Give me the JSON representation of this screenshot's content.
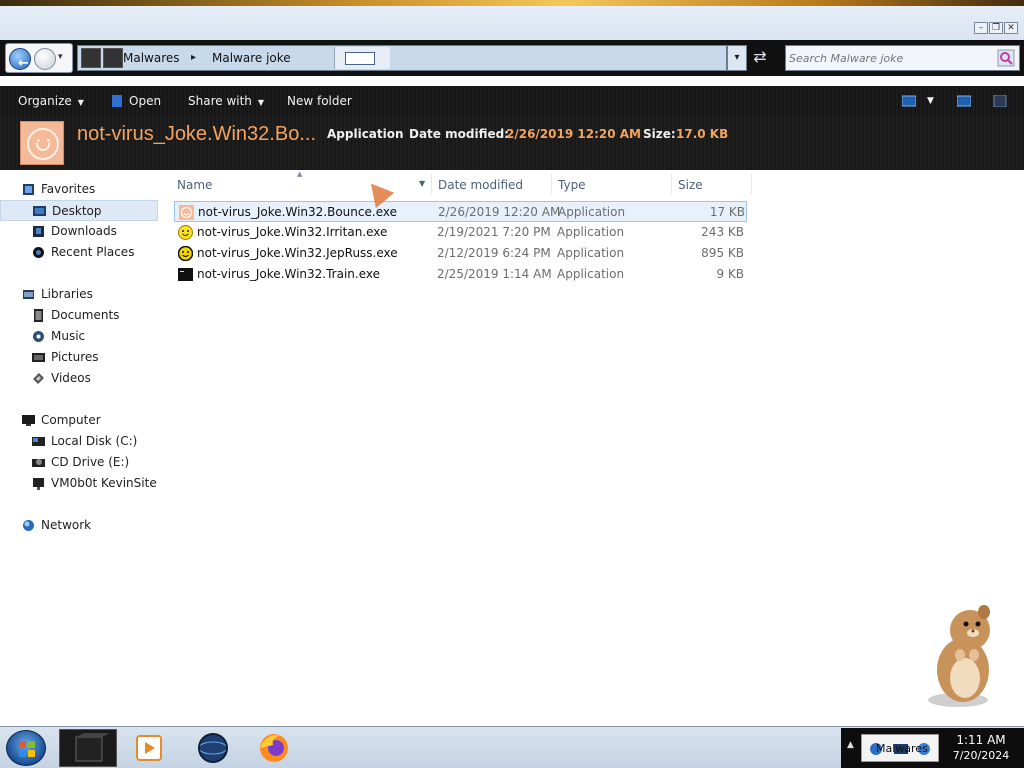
{
  "window": {
    "controls": [
      "minimize",
      "restore",
      "close"
    ]
  },
  "address_bar": {
    "back_icon": "back-arrow-icon",
    "forward_icon": "forward-arrow-icon",
    "breadcrumb": [
      "Malwares",
      "Malware joke"
    ],
    "search_placeholder": "Search Malware joke"
  },
  "toolbar": {
    "organize": "Organize",
    "open": "Open",
    "share_with": "Share with",
    "new_folder": "New folder"
  },
  "details": {
    "title": "not-virus_Joke.Win32.Bo...",
    "type": "Application",
    "date_label": "Date modified:",
    "date_value": "2/26/2019 12:20 AM",
    "size_label": "Size:",
    "size_value": "17.0 KB"
  },
  "nav": {
    "favorites": "Favorites",
    "desktop": "Desktop",
    "downloads": "Downloads",
    "recent": "Recent Places",
    "libraries": "Libraries",
    "documents": "Documents",
    "music": "Music",
    "pictures": "Pictures",
    "videos": "Videos",
    "computer": "Computer",
    "local_disk": "Local Disk (C:)",
    "cd_drive": "CD Drive (E:)",
    "kevinsite": "VM0b0t KevinSite",
    "network": "Network"
  },
  "columns": {
    "name": "Name",
    "date": "Date modified",
    "type": "Type",
    "size": "Size"
  },
  "files": [
    {
      "name": "not-virus_Joke.Win32.Bounce.exe",
      "date": "2/26/2019 12:20 AM",
      "type": "Application",
      "size": "17 KB",
      "icon": "orange-smiley-icon"
    },
    {
      "name": "not-virus_Joke.Win32.Irritan.exe",
      "date": "2/19/2021 7:20 PM",
      "type": "Application",
      "size": "243 KB",
      "icon": "yellow-smiley-icon"
    },
    {
      "name": "not-virus_Joke.Win32.JepRuss.exe",
      "date": "2/12/2019 6:24 PM",
      "type": "Application",
      "size": "895 KB",
      "icon": "smiley-icon"
    },
    {
      "name": "not-virus_Joke.Win32.Train.exe",
      "date": "2/25/2019 1:14 AM",
      "type": "Application",
      "size": "9 KB",
      "icon": "console-app-icon"
    }
  ],
  "taskbar": {
    "tray_notification": "Malwares",
    "time": "1:11 AM",
    "date": "7/20/2024"
  },
  "colors": {
    "details_accent": "#f5a45f",
    "selection": "#e8f1fb",
    "taskbar": "#c4d3e3"
  }
}
